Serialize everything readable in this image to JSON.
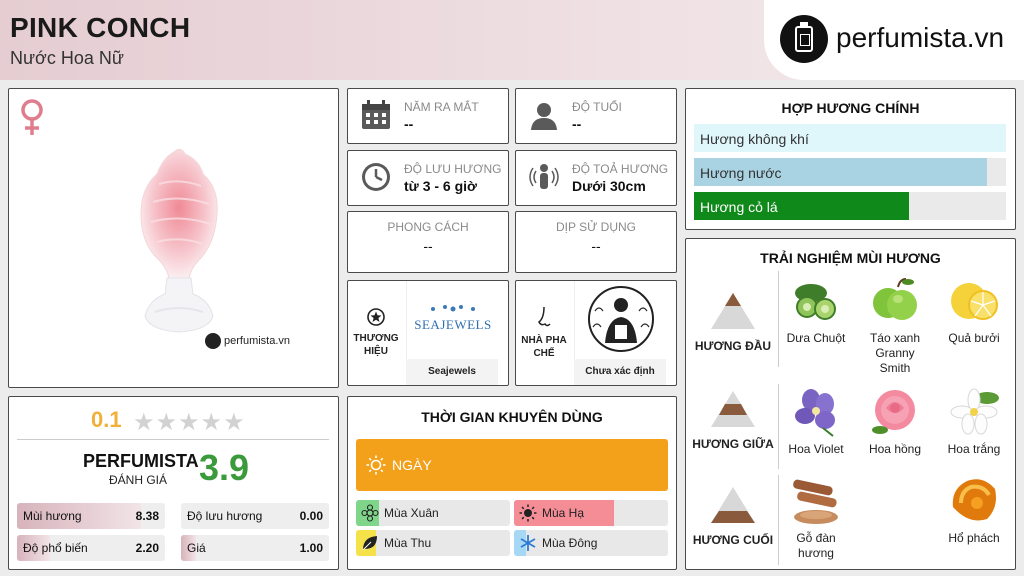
{
  "header": {
    "title": "PINK CONCH",
    "subtitle": "Nước Hoa Nữ",
    "logo_text": "perfumista.vn"
  },
  "product": {
    "image_watermark": "perfumista.vn"
  },
  "info": {
    "release_label": "NĂM RA MẮT",
    "release_value": "--",
    "age_label": "ĐỘ TUỔI",
    "age_value": "--",
    "longevity_label": "ĐỘ LƯU HƯƠNG",
    "longevity_value": "từ 3 - 6 giờ",
    "sillage_label": "ĐỘ TOẢ HƯƠNG",
    "sillage_value": "Dưới 30cm",
    "style_label": "PHONG CÁCH",
    "style_value": "--",
    "occasion_label": "DỊP SỬ DỤNG",
    "occasion_value": "--",
    "brand_label": "THƯƠNG HIỆU",
    "brand_logo_text": "SEAJEWELS",
    "brand_name": "Seajewels",
    "perfumer_label": "NHÀ PHA CHẾ",
    "perfumer_name": "Chưa xác định"
  },
  "rating": {
    "user_score": "0.1",
    "stars_display": "★★★★★",
    "pf_name": "PERFUMISTA",
    "pf_sub": "ĐÁNH GIÁ",
    "pf_score": "3.9",
    "metrics": [
      {
        "label": "Mùi hương",
        "value": "8.38",
        "fraction": 0.84
      },
      {
        "label": "Độ lưu hương",
        "value": "0.00",
        "fraction": 0.0
      },
      {
        "label": "Độ phổ biến",
        "value": "2.20",
        "fraction": 0.22
      },
      {
        "label": "Giá",
        "value": "1.00",
        "fraction": 0.1
      }
    ]
  },
  "time": {
    "title": "THỜI GIAN KHUYÊN DÙNG",
    "day_label": "NGÀY",
    "seasons": [
      {
        "label": "Mùa Xuân",
        "fraction": 0.15,
        "color": "#7fd68a"
      },
      {
        "label": "Mùa Hạ",
        "fraction": 0.65,
        "color": "#f58d97"
      },
      {
        "label": "Mùa Thu",
        "fraction": 0.13,
        "color": "#f5e14a"
      },
      {
        "label": "Mùa Đông",
        "fraction": 0.08,
        "color": "#a6d8f5"
      }
    ]
  },
  "accords": {
    "title": "HỢP HƯƠNG CHÍNH",
    "items": [
      {
        "label": "Hương không khí",
        "fraction": 1.0,
        "color": "#dff6fb",
        "text_color": "#333333"
      },
      {
        "label": "Hương nước",
        "fraction": 0.94,
        "color": "#a9d3e3",
        "text_color": "#333333"
      },
      {
        "label": "Hương cỏ lá",
        "fraction": 0.69,
        "color": "#0f8a1a",
        "text_color": "#ffffff"
      }
    ]
  },
  "notes": {
    "title": "TRẢI NGHIỆM MÙI HƯƠNG",
    "top_label": "HƯƠNG ĐẦU",
    "middle_label": "HƯƠNG GIỮA",
    "base_label": "HƯƠNG CUỐI",
    "top": [
      "Dưa Chuột",
      "Táo xanh Granny Smith",
      "Quả bưởi"
    ],
    "middle": [
      "Hoa Violet",
      "Hoa hồng",
      "Hoa trắng"
    ],
    "base": [
      "Gỗ đàn hương",
      "Hổ phách"
    ]
  }
}
